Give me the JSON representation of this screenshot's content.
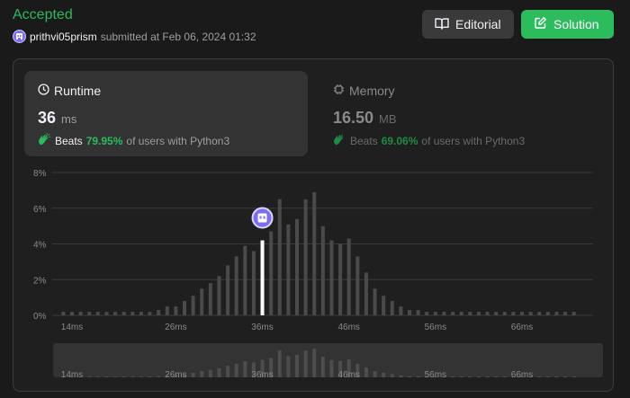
{
  "header": {
    "status": "Accepted",
    "username": "prithvi05prism",
    "submitted_text": "submitted at Feb 06, 2024 01:32"
  },
  "buttons": {
    "editorial": "Editorial",
    "solution": "Solution"
  },
  "runtime": {
    "title": "Runtime",
    "value": "36",
    "unit": "ms",
    "beats_prefix": "Beats",
    "beats_pct": "79.95%",
    "beats_suffix": "of users with Python3"
  },
  "memory": {
    "title": "Memory",
    "value": "16.50",
    "unit": "MB",
    "beats_prefix": "Beats",
    "beats_pct": "69.06%",
    "beats_suffix": "of users with Python3"
  },
  "colors": {
    "accent_green": "#2cbb5d",
    "bar": "#4a4a4a",
    "highlight_bar": "#ffffff",
    "avatar": "#7b6ff0"
  },
  "chart_data": {
    "type": "bar",
    "xlabel": "",
    "ylabel": "",
    "ylim": [
      0,
      8
    ],
    "y_ticks": [
      "0%",
      "2%",
      "4%",
      "6%",
      "8%"
    ],
    "y_tick_values": [
      0,
      2,
      4,
      6,
      8
    ],
    "x_tick_labels": [
      "14ms",
      "26ms",
      "36ms",
      "46ms",
      "56ms",
      "66ms"
    ],
    "x_tick_values": [
      14,
      26,
      36,
      46,
      56,
      66
    ],
    "x": [
      13,
      14,
      15,
      16,
      17,
      18,
      19,
      20,
      21,
      22,
      23,
      24,
      25,
      26,
      27,
      28,
      29,
      30,
      31,
      32,
      33,
      34,
      35,
      36,
      37,
      38,
      39,
      40,
      41,
      42,
      43,
      44,
      45,
      46,
      47,
      48,
      49,
      50,
      51,
      52,
      53,
      54,
      55,
      56,
      57,
      58,
      59,
      60,
      61,
      62,
      63,
      64,
      65,
      66,
      67,
      68,
      69,
      70,
      71,
      72
    ],
    "values": [
      0.2,
      0.2,
      0.2,
      0.2,
      0.2,
      0.2,
      0.2,
      0.2,
      0.2,
      0.2,
      0.2,
      0.3,
      0.5,
      0.5,
      0.8,
      1.1,
      1.5,
      1.8,
      2.2,
      2.8,
      3.3,
      3.9,
      3.6,
      4.2,
      4.7,
      6.5,
      5.1,
      5.4,
      6.5,
      6.9,
      5.0,
      4.2,
      4.0,
      4.3,
      3.3,
      2.4,
      1.5,
      1.1,
      0.8,
      0.5,
      0.3,
      0.3,
      0.2,
      0.2,
      0.2,
      0.2,
      0.2,
      0.2,
      0.2,
      0.2,
      0.2,
      0.2,
      0.2,
      0.2,
      0.2,
      0.2,
      0.2,
      0.2,
      0.2,
      0.2
    ],
    "highlight_x": 36,
    "grid": true
  }
}
